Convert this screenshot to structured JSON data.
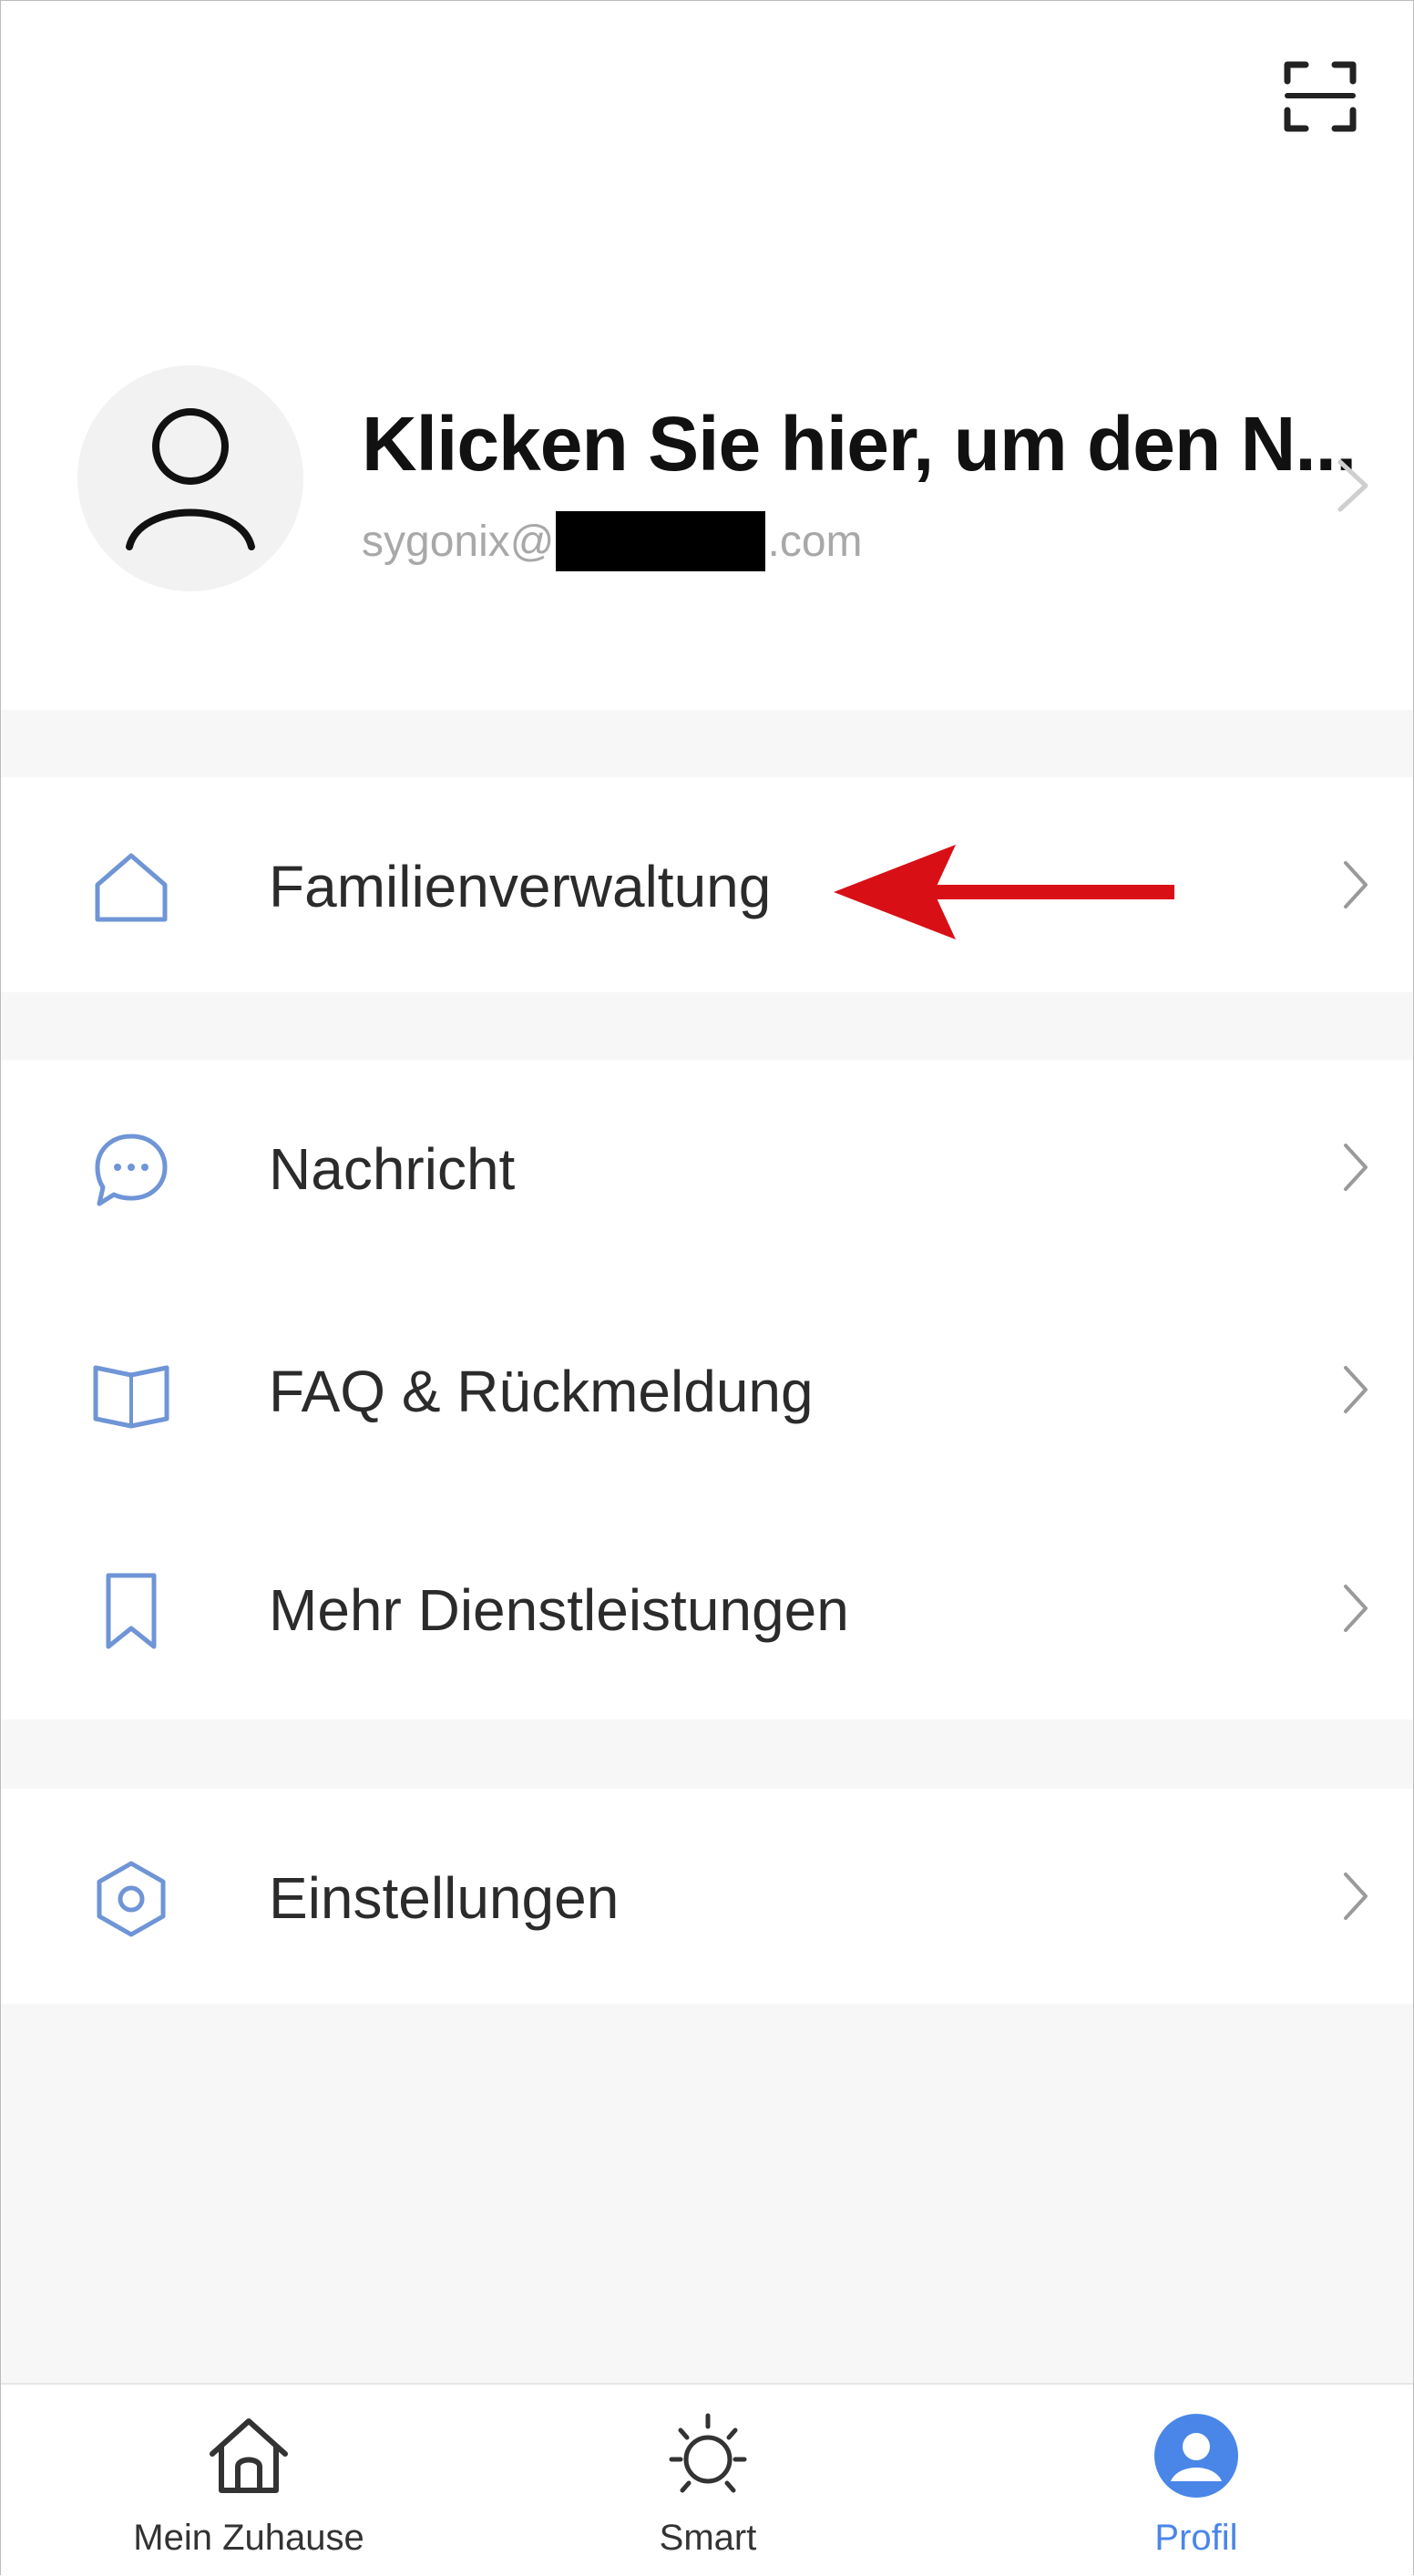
{
  "header": {
    "scan_icon": "scan-icon"
  },
  "profile": {
    "name": "Klicken Sie hier, um den N...",
    "email_prefix": "sygonix@",
    "email_suffix": ".com",
    "avatar_icon": "user-outline-icon"
  },
  "menu": {
    "family": {
      "label": "Familienverwaltung",
      "icon": "house-outline-icon"
    },
    "message": {
      "label": "Nachricht",
      "icon": "chat-bubble-icon"
    },
    "faq": {
      "label": "FAQ & Rückmeldung",
      "icon": "book-open-icon"
    },
    "services": {
      "label": "Mehr Dienstleistungen",
      "icon": "bookmark-icon"
    },
    "settings": {
      "label": "Einstellungen",
      "icon": "gear-hexagon-icon"
    }
  },
  "tabs": [
    {
      "label": "Mein Zuhause",
      "icon": "home-icon",
      "active": false
    },
    {
      "label": "Smart",
      "icon": "sun-icon",
      "active": false
    },
    {
      "label": "Profil",
      "icon": "profile-filled-icon",
      "active": true
    }
  ],
  "colors": {
    "accent": "#4a86e8",
    "icon_blue": "#6f95d6",
    "annotation_arrow": "#d90f16",
    "background": "#f7f7f7"
  }
}
